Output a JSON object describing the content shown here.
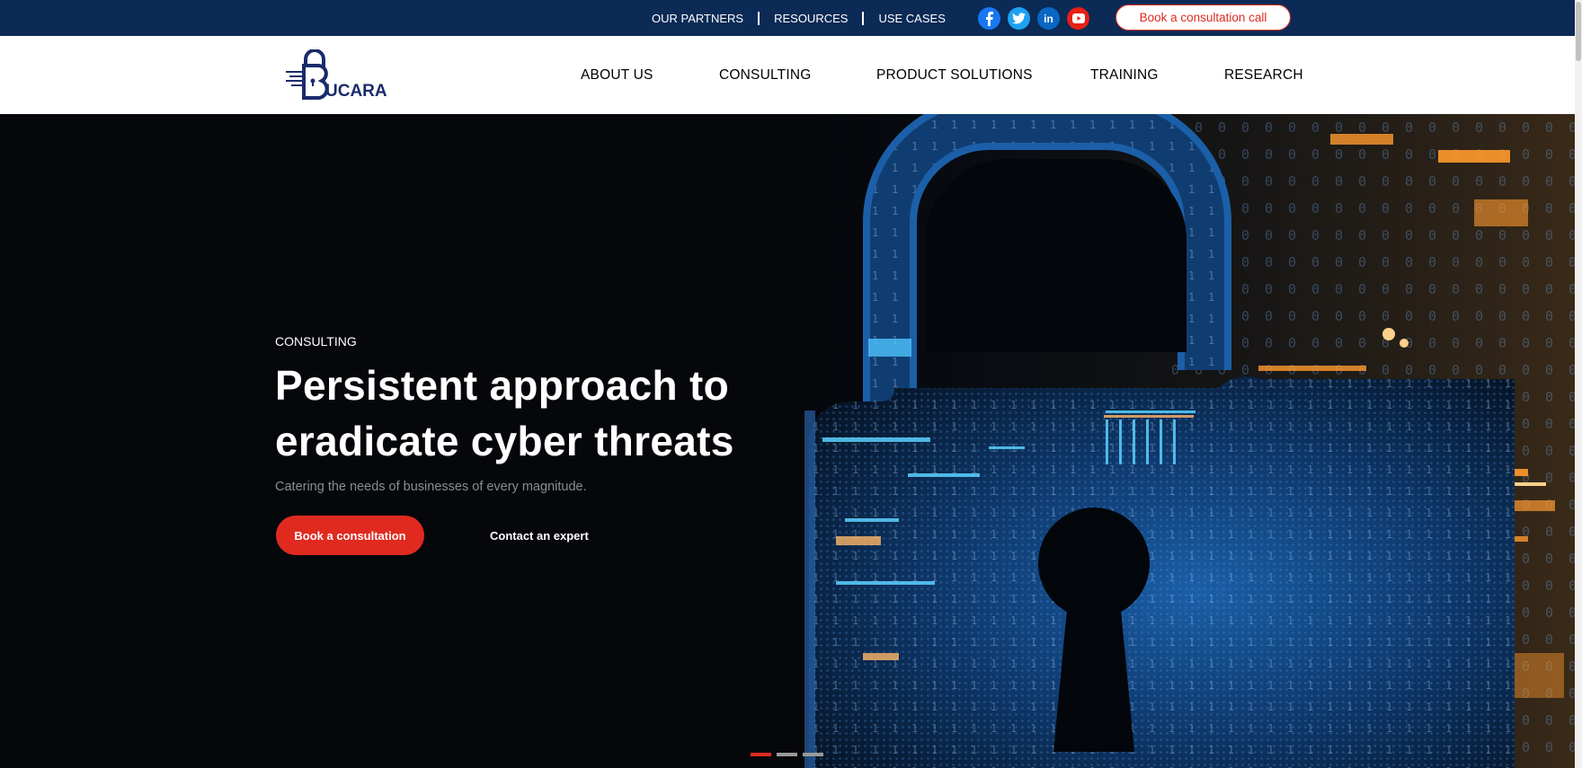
{
  "topbar": {
    "links": [
      {
        "label": "OUR PARTNERS"
      },
      {
        "label": "RESOURCES"
      },
      {
        "label": "USE CASES"
      }
    ],
    "socials": [
      {
        "name": "facebook",
        "glyph": "f",
        "color": "#1877f2"
      },
      {
        "name": "twitter",
        "glyph": "t",
        "color": "#1da1f2"
      },
      {
        "name": "linkedin",
        "glyph": "in",
        "color": "#0a66c2"
      },
      {
        "name": "youtube",
        "glyph": "▶",
        "color": "#e62117"
      }
    ],
    "cta_label": "Book a consultation call"
  },
  "header": {
    "logo_text": "UCARA",
    "nav": [
      {
        "label": "ABOUT US"
      },
      {
        "label": "CONSULTING"
      },
      {
        "label": "PRODUCT SOLUTIONS"
      },
      {
        "label": "TRAINING"
      },
      {
        "label": "RESEARCH"
      }
    ]
  },
  "hero": {
    "eyebrow": "CONSULTING",
    "headline": "Persistent approach to eradicate cyber threats",
    "subline": "Catering the needs of businesses of every magnitude.",
    "primary_cta": "Book a consultation",
    "secondary_cta": "Contact an expert",
    "slides_total": 3,
    "active_slide": 1
  },
  "colors": {
    "topbar_bg": "#0b2a56",
    "accent_red": "#e02a1f",
    "brand_navy": "#1a2b6b",
    "hero_bg": "#05070b"
  }
}
